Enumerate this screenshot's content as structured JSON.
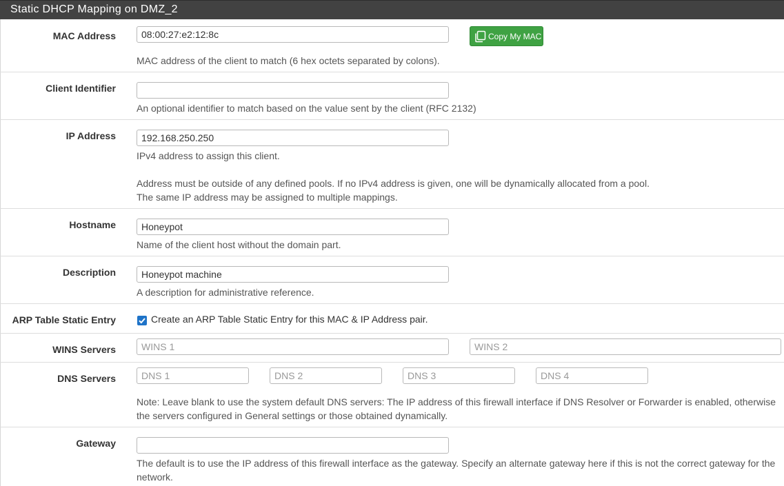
{
  "panel": {
    "title": "Static DHCP Mapping on DMZ_2"
  },
  "mac": {
    "label": "MAC Address",
    "value": "08:00:27:e2:12:8c",
    "copy_button": "Copy My MAC",
    "help": "MAC address of the client to match (6 hex octets separated by colons)."
  },
  "client_id": {
    "label": "Client Identifier",
    "value": "",
    "help": "An optional identifier to match based on the value sent by the client (RFC 2132)"
  },
  "ip": {
    "label": "IP Address",
    "value": "192.168.250.250",
    "help1": "IPv4 address to assign this client.",
    "help2": "Address must be outside of any defined pools. If no IPv4 address is given, one will be dynamically allocated from a pool.",
    "help3": "The same IP address may be assigned to multiple mappings."
  },
  "hostname": {
    "label": "Hostname",
    "value": "Honeypot",
    "help": "Name of the client host without the domain part."
  },
  "description": {
    "label": "Description",
    "value": "Honeypot machine",
    "help": "A description for administrative reference."
  },
  "arp": {
    "label": "ARP Table Static Entry",
    "checked": true,
    "checkbox_label": "Create an ARP Table Static Entry for this MAC & IP Address pair."
  },
  "wins": {
    "label": "WINS Servers",
    "placeholders": [
      "WINS 1",
      "WINS 2"
    ]
  },
  "dns": {
    "label": "DNS Servers",
    "placeholders": [
      "DNS 1",
      "DNS 2",
      "DNS 3",
      "DNS 4"
    ],
    "help1": "Note: Leave blank to use the system default DNS servers: The IP address of this firewall interface if DNS Resolver or Forwarder is enabled, otherwise",
    "help2": "the servers configured in General settings or those obtained dynamically."
  },
  "gateway": {
    "label": "Gateway",
    "value": "",
    "help1": "The default is to use the IP address of this firewall interface as the gateway. Specify an alternate gateway here if this is not the correct gateway for the",
    "help2": "network."
  },
  "colors": {
    "heading_bg": "#424242",
    "button_green": "#3fa243",
    "checkbox_blue": "#1e73c8"
  }
}
